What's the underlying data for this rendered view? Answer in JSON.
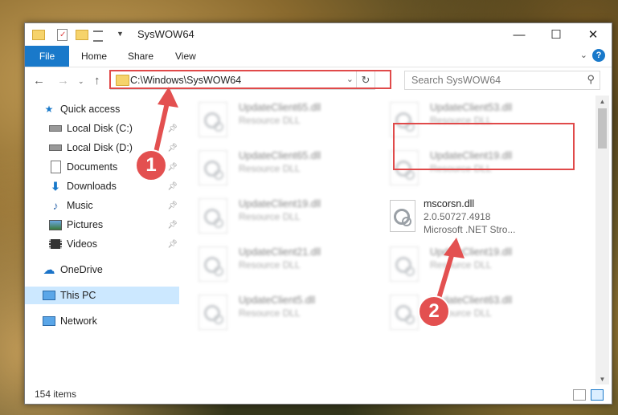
{
  "window": {
    "title": "SysWOW64",
    "controls": {
      "minimize": "—",
      "maximize": "☐",
      "close": "✕"
    }
  },
  "ribbon": {
    "file": "File",
    "tabs": [
      "Home",
      "Share",
      "View"
    ],
    "help": "?"
  },
  "address": {
    "path": "C:\\Windows\\SysWOW64",
    "search_placeholder": "Search SysWOW64"
  },
  "nav": {
    "quick_access": "Quick access",
    "items": [
      {
        "label": "Local Disk (C:)",
        "pinned": true
      },
      {
        "label": "Local Disk (D:)",
        "pinned": true
      },
      {
        "label": "Documents",
        "pinned": true
      },
      {
        "label": "Downloads",
        "pinned": true
      },
      {
        "label": "Music",
        "pinned": true
      },
      {
        "label": "Pictures",
        "pinned": true
      },
      {
        "label": "Videos",
        "pinned": true
      }
    ],
    "onedrive": "OneDrive",
    "this_pc": "This PC",
    "network": "Network"
  },
  "files": [
    {
      "name": "UpdateClient65.dll",
      "type": "Resource DLL"
    },
    {
      "name": "UpdateClient53.dll",
      "type": "Resource DLL"
    },
    {
      "name": "UpdateClient65.dll",
      "type": "Resource DLL"
    },
    {
      "name": "UpdateClient19.dll",
      "type": "Resource DLL"
    },
    {
      "name": "UpdateClient19.dll",
      "type": "Resource DLL"
    },
    {
      "name": "UpdateClient21.dll",
      "type": "Resource DLL"
    },
    {
      "name": "UpdateClient19.dll",
      "type": "Resource DLL"
    },
    {
      "name": "UpdateClient5.dll",
      "type": "Resource DLL"
    },
    {
      "name": "UpdateClient63.dll",
      "type": "Resource DLL"
    }
  ],
  "highlighted_file": {
    "name": "mscorsn.dll",
    "version": "2.0.50727.4918",
    "company": "Microsoft .NET Stro..."
  },
  "status": {
    "items": "154 items"
  },
  "callouts": {
    "one": "1",
    "two": "2"
  },
  "colors": {
    "accent": "#1979ca",
    "highlight": "#e04a4a",
    "selection": "#cce8ff"
  }
}
